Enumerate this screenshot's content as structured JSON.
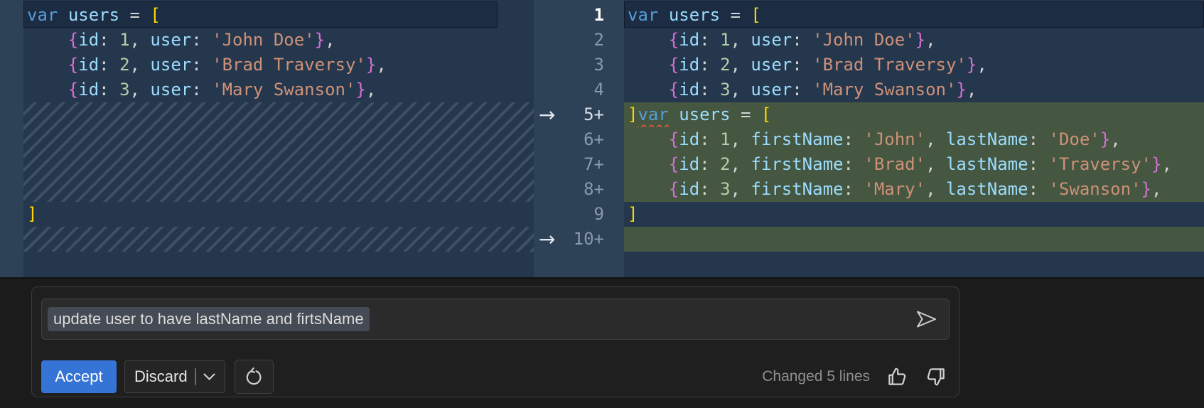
{
  "colors": {
    "editor_bg": "#25374D",
    "gutter_bg": "#2D4157",
    "active_line_bg": "#1C2C43",
    "active_line_border": "#0F1B2B",
    "added_line_bg": "#455741",
    "hatch_stripe": "#3E5066",
    "line_num": "#8A99AB",
    "line_num_active": "#FFFFFF",
    "line_num_bright": "#D8E0EA",
    "arrow": "#E2E8F0",
    "panel_bg": "#1B1B1B",
    "widget_bg": "#1F1F1F",
    "widget_border": "#3B3B3B",
    "input_bg": "#2B2B2B",
    "input_border": "#404040",
    "selection_bg": "#454B55",
    "input_text": "#DCDCDC",
    "accent_blue": "#3574D4",
    "button_dark_bg": "#252525",
    "button_border": "#414141",
    "status_text": "#8F8F8F",
    "icon": "#D0D0D0",
    "syntax": {
      "keyword": "#569CD6",
      "property": "#9CDCFE",
      "operator": "#D4D4D4",
      "number": "#B5CEA8",
      "string": "#CE9178",
      "bracket_square": "#FFD700",
      "bracket_curly": "#D670D6",
      "squiggle": "#C15B40"
    }
  },
  "editor": {
    "left_rows": [
      {
        "type": "code",
        "tokens": [
          [
            "k",
            "var"
          ],
          [
            "o",
            " "
          ],
          [
            "p",
            "users"
          ],
          [
            "o",
            " = "
          ],
          [
            "b",
            "["
          ]
        ]
      },
      {
        "type": "code",
        "tokens": [
          [
            "o",
            "    "
          ],
          [
            "c",
            "{"
          ],
          [
            "p",
            "id"
          ],
          [
            "o",
            ": "
          ],
          [
            "n",
            "1"
          ],
          [
            "o",
            ", "
          ],
          [
            "p",
            "user"
          ],
          [
            "o",
            ": "
          ],
          [
            "s",
            "'John Doe'"
          ],
          [
            "c",
            "}"
          ],
          [
            "o",
            ","
          ]
        ]
      },
      {
        "type": "code",
        "tokens": [
          [
            "o",
            "    "
          ],
          [
            "c",
            "{"
          ],
          [
            "p",
            "id"
          ],
          [
            "o",
            ": "
          ],
          [
            "n",
            "2"
          ],
          [
            "o",
            ", "
          ],
          [
            "p",
            "user"
          ],
          [
            "o",
            ": "
          ],
          [
            "s",
            "'Brad Traversy'"
          ],
          [
            "c",
            "}"
          ],
          [
            "o",
            ","
          ]
        ]
      },
      {
        "type": "code",
        "tokens": [
          [
            "o",
            "    "
          ],
          [
            "c",
            "{"
          ],
          [
            "p",
            "id"
          ],
          [
            "o",
            ": "
          ],
          [
            "n",
            "3"
          ],
          [
            "o",
            ", "
          ],
          [
            "p",
            "user"
          ],
          [
            "o",
            ": "
          ],
          [
            "s",
            "'Mary Swanson'"
          ],
          [
            "c",
            "}"
          ],
          [
            "o",
            ","
          ]
        ]
      },
      {
        "type": "hatch",
        "span": 4
      },
      {
        "type": "code",
        "tokens": [
          [
            "b",
            "]"
          ]
        ]
      },
      {
        "type": "hatch",
        "span": 1
      }
    ],
    "right_rows": [
      {
        "type": "code",
        "tokens": [
          [
            "k",
            "var"
          ],
          [
            "o",
            " "
          ],
          [
            "p",
            "users"
          ],
          [
            "o",
            " = "
          ],
          [
            "b",
            "["
          ]
        ]
      },
      {
        "type": "code",
        "tokens": [
          [
            "o",
            "    "
          ],
          [
            "c",
            "{"
          ],
          [
            "p",
            "id"
          ],
          [
            "o",
            ": "
          ],
          [
            "n",
            "1"
          ],
          [
            "o",
            ", "
          ],
          [
            "p",
            "user"
          ],
          [
            "o",
            ": "
          ],
          [
            "s",
            "'John Doe'"
          ],
          [
            "c",
            "}"
          ],
          [
            "o",
            ","
          ]
        ]
      },
      {
        "type": "code",
        "tokens": [
          [
            "o",
            "    "
          ],
          [
            "c",
            "{"
          ],
          [
            "p",
            "id"
          ],
          [
            "o",
            ": "
          ],
          [
            "n",
            "2"
          ],
          [
            "o",
            ", "
          ],
          [
            "p",
            "user"
          ],
          [
            "o",
            ": "
          ],
          [
            "s",
            "'Brad Traversy'"
          ],
          [
            "c",
            "}"
          ],
          [
            "o",
            ","
          ]
        ]
      },
      {
        "type": "code",
        "tokens": [
          [
            "o",
            "    "
          ],
          [
            "c",
            "{"
          ],
          [
            "p",
            "id"
          ],
          [
            "o",
            ": "
          ],
          [
            "n",
            "3"
          ],
          [
            "o",
            ", "
          ],
          [
            "p",
            "user"
          ],
          [
            "o",
            ": "
          ],
          [
            "s",
            "'Mary Swanson'"
          ],
          [
            "c",
            "}"
          ],
          [
            "o",
            ","
          ]
        ]
      },
      {
        "type": "code",
        "added": true,
        "tokens": [
          [
            "b",
            "]"
          ],
          [
            "e",
            "var"
          ],
          [
            "o",
            " "
          ],
          [
            "p",
            "users"
          ],
          [
            "o",
            " = "
          ],
          [
            "b",
            "["
          ]
        ]
      },
      {
        "type": "code",
        "added": true,
        "tokens": [
          [
            "o",
            "    "
          ],
          [
            "c",
            "{"
          ],
          [
            "p",
            "id"
          ],
          [
            "o",
            ": "
          ],
          [
            "n",
            "1"
          ],
          [
            "o",
            ", "
          ],
          [
            "p",
            "firstName"
          ],
          [
            "o",
            ": "
          ],
          [
            "s",
            "'John'"
          ],
          [
            "o",
            ", "
          ],
          [
            "p",
            "lastName"
          ],
          [
            "o",
            ": "
          ],
          [
            "s",
            "'Doe'"
          ],
          [
            "c",
            "}"
          ],
          [
            "o",
            ","
          ]
        ]
      },
      {
        "type": "code",
        "added": true,
        "tokens": [
          [
            "o",
            "    "
          ],
          [
            "c",
            "{"
          ],
          [
            "p",
            "id"
          ],
          [
            "o",
            ": "
          ],
          [
            "n",
            "2"
          ],
          [
            "o",
            ", "
          ],
          [
            "p",
            "firstName"
          ],
          [
            "o",
            ": "
          ],
          [
            "s",
            "'Brad'"
          ],
          [
            "o",
            ", "
          ],
          [
            "p",
            "lastName"
          ],
          [
            "o",
            ": "
          ],
          [
            "s",
            "'Traversy'"
          ],
          [
            "c",
            "}"
          ],
          [
            "o",
            ","
          ]
        ]
      },
      {
        "type": "code",
        "added": true,
        "tokens": [
          [
            "o",
            "    "
          ],
          [
            "c",
            "{"
          ],
          [
            "p",
            "id"
          ],
          [
            "o",
            ": "
          ],
          [
            "n",
            "3"
          ],
          [
            "o",
            ", "
          ],
          [
            "p",
            "firstName"
          ],
          [
            "o",
            ": "
          ],
          [
            "s",
            "'Mary'"
          ],
          [
            "o",
            ", "
          ],
          [
            "p",
            "lastName"
          ],
          [
            "o",
            ": "
          ],
          [
            "s",
            "'Swanson'"
          ],
          [
            "c",
            "}"
          ],
          [
            "o",
            ","
          ]
        ]
      },
      {
        "type": "code",
        "tokens": [
          [
            "b",
            "]"
          ]
        ]
      },
      {
        "type": "code",
        "added": true,
        "tokens": []
      }
    ],
    "gutter": {
      "arrow_glyph": "→",
      "rows": [
        {
          "label": "1",
          "active": true
        },
        {
          "label": "2"
        },
        {
          "label": "3"
        },
        {
          "label": "4"
        },
        {
          "label": "5+",
          "bright": true,
          "arrow": true
        },
        {
          "label": "6+"
        },
        {
          "label": "7+"
        },
        {
          "label": "8+"
        },
        {
          "label": "9"
        },
        {
          "label": "10+",
          "arrow": true
        }
      ]
    }
  },
  "inline_chat": {
    "input_value": "update user to have lastName and firtsName",
    "accept_label": "Accept",
    "discard_label": "Discard",
    "status_text": "Changed 5 lines",
    "icons": {
      "send": "send-paper-plane",
      "retry": "refresh-circular-arrow",
      "discard_more": "chevron-down",
      "positive": "thumbs-up",
      "negative": "thumbs-down"
    }
  }
}
